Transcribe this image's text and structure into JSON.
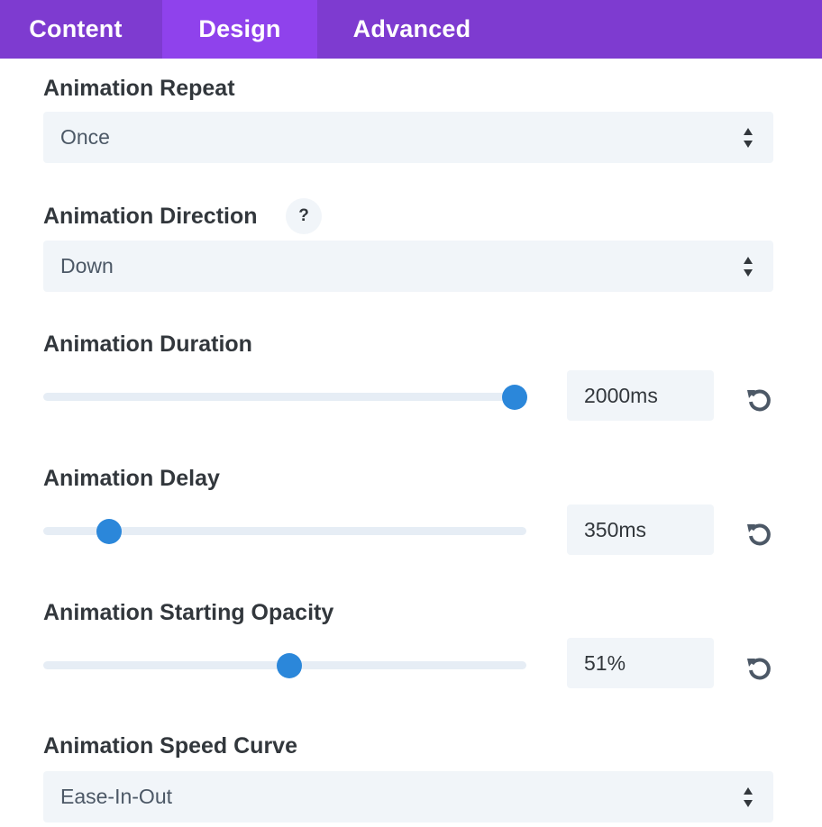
{
  "tabs": [
    {
      "label": "Content",
      "active": false
    },
    {
      "label": "Design",
      "active": true
    },
    {
      "label": "Advanced",
      "active": false
    }
  ],
  "fields": {
    "repeat": {
      "label": "Animation Repeat",
      "value": "Once"
    },
    "direction": {
      "label": "Animation Direction",
      "help": "?",
      "value": "Down"
    },
    "duration": {
      "label": "Animation Duration",
      "value": "2000ms",
      "slider_fraction": 0.975
    },
    "delay": {
      "label": "Animation Delay",
      "value": "350ms",
      "slider_fraction": 0.136
    },
    "opacity": {
      "label": "Animation Starting Opacity",
      "value": "51%",
      "slider_fraction": 0.51
    },
    "speed_curve": {
      "label": "Animation Speed Curve",
      "value": "Ease-In-Out"
    }
  },
  "colors": {
    "tab_bar": "#7e3bd0",
    "tab_active": "#8f42ec",
    "slider_thumb": "#2b87da",
    "slider_track": "#e6edf5",
    "field_bg": "#f1f5f9"
  },
  "icons": {
    "select_arrows": "updown-arrows-icon",
    "reset": "reset-icon"
  }
}
